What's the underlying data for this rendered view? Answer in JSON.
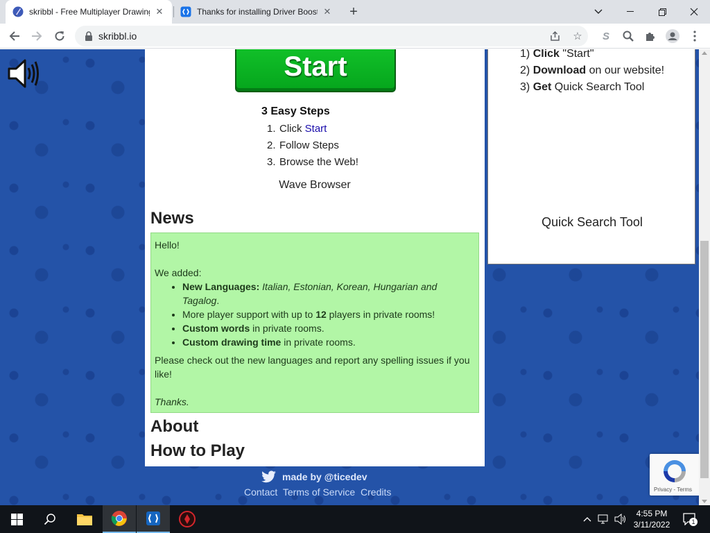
{
  "browser": {
    "tabs": [
      {
        "title": "skribbl - Free Multiplayer Drawing",
        "active": true
      },
      {
        "title": "Thanks for installing Driver Booster",
        "active": false
      }
    ],
    "url": "skribbl.io"
  },
  "page": {
    "start_label": "Start",
    "steps_title": "3 Easy Steps",
    "steps": [
      {
        "num": "1.",
        "text": "Click ",
        "link": "Start"
      },
      {
        "num": "2.",
        "text": "Follow Steps",
        "link": ""
      },
      {
        "num": "3.",
        "text": "Browse the Web!",
        "link": ""
      }
    ],
    "wave_label": "Wave Browser",
    "news_title": "News",
    "news": {
      "greeting": "Hello!",
      "added": "We added:",
      "items": [
        {
          "bold": "New Languages:",
          "italic": "Italian, Estonian, Korean, Hungarian and Tagalog",
          "rest": "."
        },
        {
          "pre": "More player support with up to ",
          "bold": "12",
          "post": " players in private rooms!"
        },
        {
          "bold": "Custom words",
          "post": " in private rooms."
        },
        {
          "bold": "Custom drawing time",
          "post": " in private rooms."
        }
      ],
      "body": "Please check out the new languages and report any spelling issues if you like!",
      "signoff": "Thanks."
    },
    "about_title": "About",
    "howto_title": "How to Play",
    "ad": {
      "steps": [
        {
          "num": "1)",
          "bold": "Click",
          "rest": " \"Start\""
        },
        {
          "num": "2)",
          "bold": "Download",
          "rest": " on our website!"
        },
        {
          "num": "3)",
          "bold": "Get",
          "rest": " Quick Search Tool"
        }
      ],
      "caption": "Quick Search Tool"
    },
    "footer": {
      "made_by": "made by @ticedev",
      "links": [
        "Contact",
        "Terms of Service",
        "Credits"
      ]
    },
    "recaptcha": {
      "privacy": "Privacy",
      "separator": " - ",
      "terms": "Terms"
    }
  },
  "taskbar": {
    "time": "4:55 PM",
    "date": "3/11/2022",
    "notification_count": "1"
  },
  "colors": {
    "page_background": "#2453a8",
    "start_button": "#0cb625",
    "news_background": "#b2f6a6"
  }
}
